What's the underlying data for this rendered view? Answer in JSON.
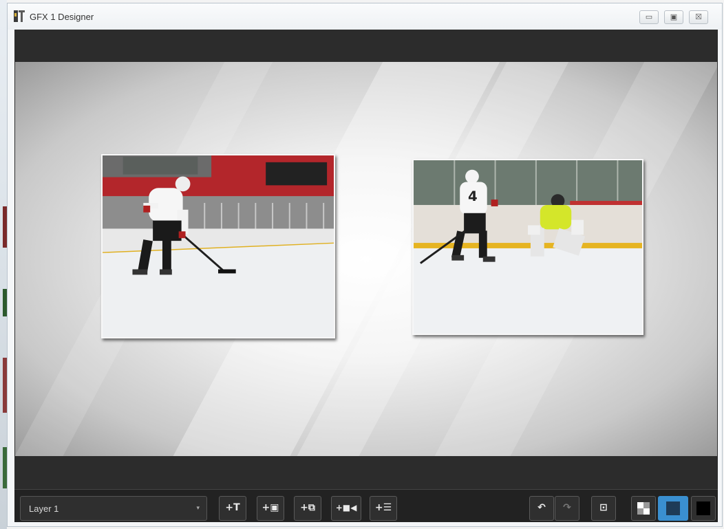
{
  "window": {
    "title": "GFX 1 Designer",
    "controls": {
      "minimize": "▭",
      "restore": "▣",
      "close": "☒"
    }
  },
  "canvas": {
    "images": [
      {
        "name": "hockey-skater-photo"
      },
      {
        "name": "hockey-shooter-goalie-photo"
      }
    ]
  },
  "toolbar": {
    "layer_select": {
      "value": "Layer 1",
      "caret": "▾"
    },
    "buttons": {
      "add_text": "+T",
      "add_image": "+▣",
      "add_media": "+⧉",
      "add_video": "+■◀",
      "add_list": "+☰",
      "undo": "↶",
      "redo": "↷",
      "fit": "⊡"
    },
    "background_modes": {
      "transparent_color": "#ffffff",
      "dark_color": "#1e3b57",
      "black_color": "#000000",
      "active": "dark"
    }
  },
  "colors": {
    "accent": "#3a8fd0",
    "panel": "#2c2c2c",
    "toolbar": "#222222"
  }
}
